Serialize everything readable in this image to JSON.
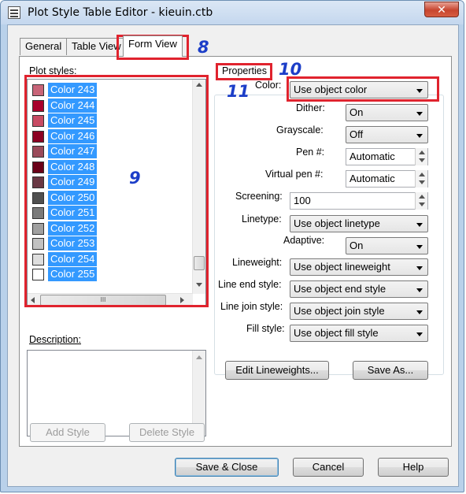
{
  "window": {
    "title": "Plot Style Table Editor - kieuin.ctb",
    "close_glyph": "✕"
  },
  "tabs": [
    {
      "label": "General"
    },
    {
      "label": "Table View"
    },
    {
      "label": "Form View"
    }
  ],
  "plot_styles": {
    "label": "Plot styles:",
    "items": [
      {
        "label": "Color 243",
        "color": "#c86478"
      },
      {
        "label": "Color 244",
        "color": "#a8002c"
      },
      {
        "label": "Color 245",
        "color": "#c84b64"
      },
      {
        "label": "Color 246",
        "color": "#8c0022"
      },
      {
        "label": "Color 247",
        "color": "#9a4a5a"
      },
      {
        "label": "Color 248",
        "color": "#6a0018"
      },
      {
        "label": "Color 249",
        "color": "#6a3844"
      },
      {
        "label": "Color 250",
        "color": "#505050"
      },
      {
        "label": "Color 251",
        "color": "#7a7a7a"
      },
      {
        "label": "Color 252",
        "color": "#a0a0a0"
      },
      {
        "label": "Color 253",
        "color": "#c2c2c2"
      },
      {
        "label": "Color 254",
        "color": "#dedede"
      },
      {
        "label": "Color 255",
        "color": "#ffffff"
      }
    ],
    "hscroll_grip": "III"
  },
  "description": {
    "label": "Description:"
  },
  "buttons": {
    "add_style": "Add Style",
    "delete_style": "Delete Style",
    "edit_lineweights": "Edit Lineweights...",
    "save_as": "Save As...",
    "save_close": "Save & Close",
    "cancel": "Cancel",
    "help": "Help"
  },
  "properties": {
    "group_label": "Properties",
    "color": {
      "label": "Color:",
      "value": "Use object color"
    },
    "dither": {
      "label": "Dither:",
      "value": "On"
    },
    "grayscale": {
      "label": "Grayscale:",
      "value": "Off"
    },
    "pen": {
      "label": "Pen #:",
      "value": "Automatic"
    },
    "virtual_pen": {
      "label": "Virtual pen #:",
      "value": "Automatic"
    },
    "screening": {
      "label": "Screening:",
      "value": "100"
    },
    "linetype": {
      "label": "Linetype:",
      "value": "Use object linetype"
    },
    "adaptive": {
      "label": "Adaptive:",
      "value": "On"
    },
    "lineweight": {
      "label": "Lineweight:",
      "value": "Use object lineweight"
    },
    "line_end": {
      "label": "Line end style:",
      "value": "Use object end style"
    },
    "line_join": {
      "label": "Line join style:",
      "value": "Use object join style"
    },
    "fill": {
      "label": "Fill style:",
      "value": "Use object fill style"
    }
  },
  "callouts": {
    "c8": "8",
    "c9": "9",
    "c10": "10",
    "c11": "11"
  },
  "colors": {
    "annotation_red": "#e0232e",
    "annotation_blue": "#1c3ec8",
    "selection": "#3399ff"
  }
}
